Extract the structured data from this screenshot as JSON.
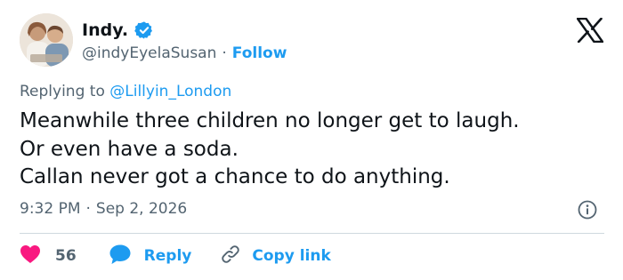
{
  "author": {
    "display_name": "Indy.",
    "handle": "@indyEyelaSusan",
    "separator": "·",
    "follow_label": "Follow",
    "verified_color": "#1d9bf0"
  },
  "reply_context": {
    "prefix": "Replying to ",
    "mention": "@Lillyin_London"
  },
  "tweet": {
    "lines": [
      "Meanwhile three children no longer get to laugh.",
      "Or even have a soda.",
      "Callan never got a chance to do anything."
    ],
    "time": "9:32 PM",
    "separator": "·",
    "date": "Sep 2, 2026"
  },
  "actions": {
    "like_count": "56",
    "reply_label": "Reply",
    "copy_link_label": "Copy link"
  },
  "colors": {
    "accent": "#1d9bf0",
    "like": "#f91880",
    "muted": "#536471",
    "text": "#0f1419"
  },
  "icons": {
    "brand": "x-logo-icon",
    "verified": "verified-badge-icon",
    "info": "info-icon",
    "like": "heart-icon",
    "reply": "speech-bubble-icon",
    "copy": "link-icon"
  }
}
